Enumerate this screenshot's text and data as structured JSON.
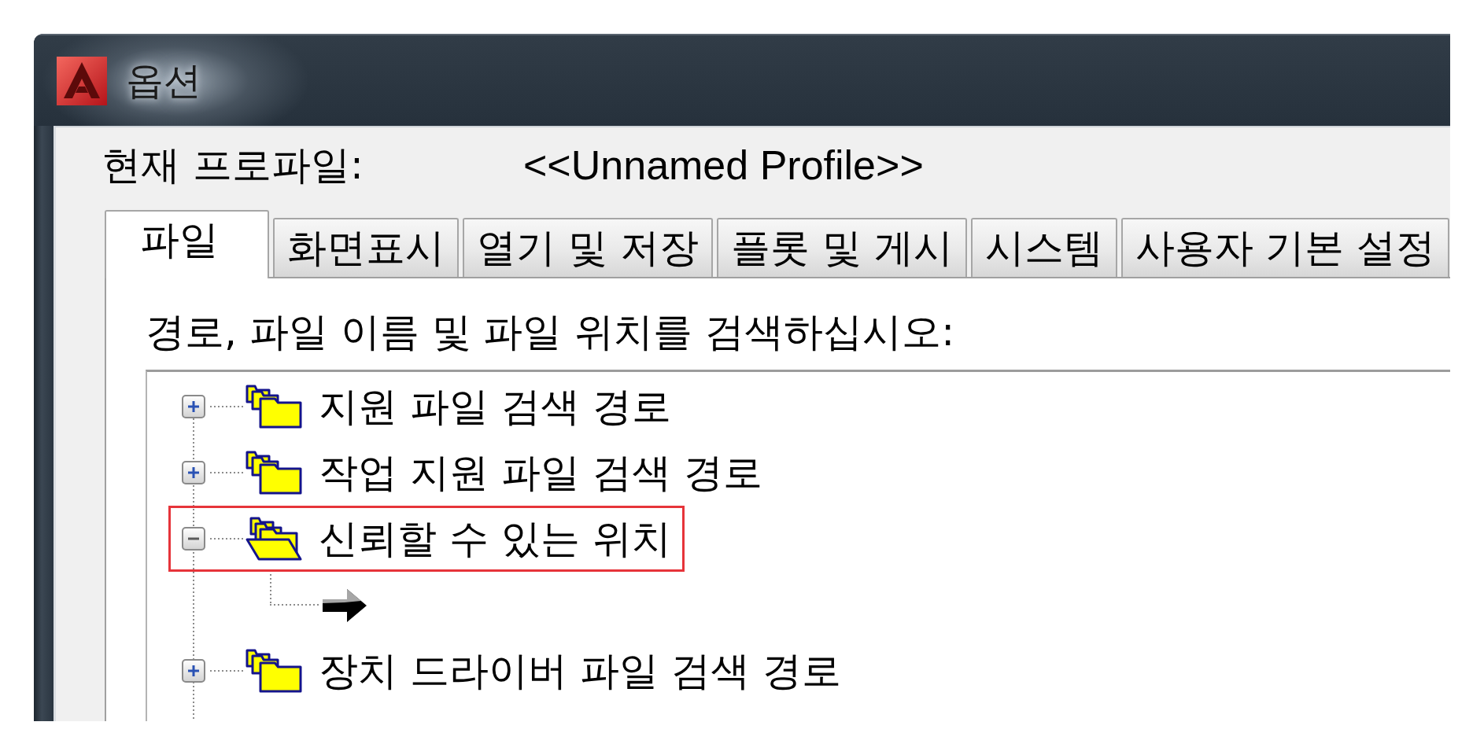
{
  "window": {
    "title": "옵션"
  },
  "profile": {
    "label": "현재 프로파일:",
    "value": "<<Unnamed Profile>>"
  },
  "tabs": [
    {
      "label": "파일",
      "selected": true
    },
    {
      "label": "화면표시",
      "selected": false
    },
    {
      "label": "열기 및 저장",
      "selected": false
    },
    {
      "label": "플롯 및 게시",
      "selected": false
    },
    {
      "label": "시스템",
      "selected": false
    },
    {
      "label": "사용자 기본 설정",
      "selected": false
    }
  ],
  "panel": {
    "instruction": "경로, 파일 이름 및 파일 위치를 검색하십시오:"
  },
  "tree": [
    {
      "label": "지원 파일 검색 경로",
      "expanded": false,
      "highlighted": false
    },
    {
      "label": "작업 지원 파일 검색 경로",
      "expanded": false,
      "highlighted": false
    },
    {
      "label": "신뢰할 수 있는 위치",
      "expanded": true,
      "highlighted": true,
      "children": [
        {
          "kind": "entry"
        }
      ]
    },
    {
      "label": "장치 드라이버 파일 검색 경로",
      "expanded": false,
      "highlighted": false
    }
  ]
}
